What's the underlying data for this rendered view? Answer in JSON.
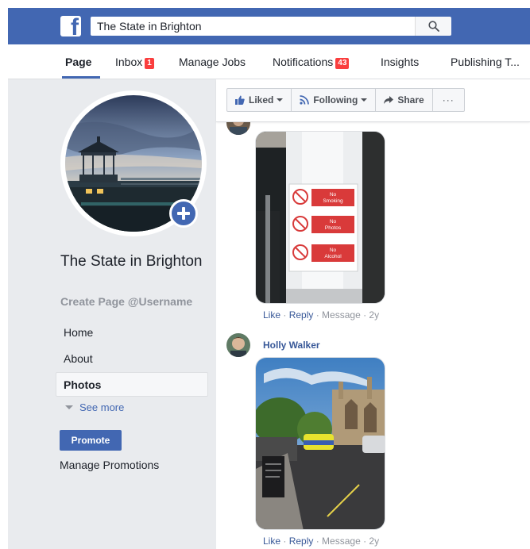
{
  "topbar": {
    "search_value": "The State in Brighton",
    "logo_letter": "f"
  },
  "nav": {
    "items": [
      {
        "label": "Page",
        "active": true
      },
      {
        "label": "Inbox",
        "badge": "1"
      },
      {
        "label": "Manage Jobs"
      },
      {
        "label": "Notifications",
        "badge": "43"
      },
      {
        "label": "Insights"
      },
      {
        "label": "Publishing T..."
      }
    ]
  },
  "sidebar": {
    "page_title": "The State in Brighton",
    "username_link": "Create Page @Username",
    "links": [
      "Home",
      "About",
      "Photos"
    ],
    "see_more": "See more",
    "promote": "Promote",
    "manage_promotions": "Manage Promotions"
  },
  "actions": {
    "liked": "Liked",
    "following": "Following",
    "share": "Share",
    "more": "···"
  },
  "feed": {
    "comments": [
      {
        "meta": {
          "like": "Like",
          "reply": "Reply",
          "message": "Message",
          "time": "2y"
        },
        "sign_lines": [
          [
            "No",
            "Smoking"
          ],
          [
            "No",
            "Photos"
          ],
          [
            "No",
            "Alcohol"
          ]
        ]
      },
      {
        "author": "Holly Walker",
        "meta": {
          "like": "Like",
          "reply": "Reply",
          "message": "Message",
          "time": "2y"
        }
      }
    ],
    "separator": " · "
  },
  "colors": {
    "brand_blue": "#4267b2",
    "link_blue": "#385898",
    "badge_red": "#fa3e3e",
    "sidebar_bg": "#e9ebee"
  }
}
